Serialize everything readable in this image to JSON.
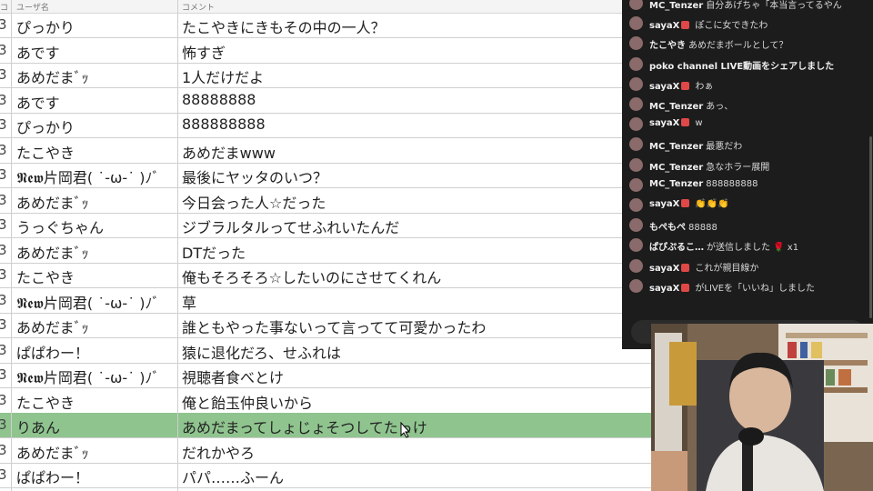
{
  "table": {
    "headers": [
      "コ",
      "ユーザ名",
      "コメント"
    ],
    "rows": [
      {
        "num": "3",
        "user": "ぴっかり",
        "comment": "たこやきにきもその中の一人？"
      },
      {
        "num": "3",
        "user": "あです",
        "comment": "怖すぎ"
      },
      {
        "num": "3",
        "user": "あめだまﾞｯ",
        "comment": "1人だけだよ"
      },
      {
        "num": "3",
        "user": "あです",
        "comment": "88888888"
      },
      {
        "num": "3",
        "user": "ぴっかり",
        "comment": "888888888"
      },
      {
        "num": "3",
        "user": "たこやき",
        "comment": "あめだまwww"
      },
      {
        "num": "3",
        "user": "𝕹𝖊𝖜片岡君( ˙-ω-˙ )ﾉﾞ",
        "comment": "最後にヤッタのいつ？"
      },
      {
        "num": "3",
        "user": "あめだまﾞｯ",
        "comment": "今日会った人☆だった"
      },
      {
        "num": "3",
        "user": "うっぐちゃん",
        "comment": "ジブラルタルってせふれいたんだ"
      },
      {
        "num": "3",
        "user": "あめだまﾞｯ",
        "comment": "DTだった"
      },
      {
        "num": "3",
        "user": "たこやき",
        "comment": "俺もそろそろ☆したいのにさせてくれん"
      },
      {
        "num": "3",
        "user": "𝕹𝖊𝖜片岡君( ˙-ω-˙ )ﾉﾞ",
        "comment": "草"
      },
      {
        "num": "3",
        "user": "あめだまﾞｯ",
        "comment": "誰ともやった事ないって言ってて可愛かったわ"
      },
      {
        "num": "3",
        "user": "ぱぱわー！",
        "comment": "猿に退化だろ、せふれは"
      },
      {
        "num": "3",
        "user": "𝕹𝖊𝖜片岡君( ˙-ω-˙ )ﾉﾞ",
        "comment": "視聴者食べとけ"
      },
      {
        "num": "3",
        "user": "たこやき",
        "comment": "俺と飴玉仲良いから"
      },
      {
        "num": "3",
        "user": "りあん",
        "comment": "あめだまってしょじょそつしてたっけ",
        "selected": true
      },
      {
        "num": "3",
        "user": "あめだまﾞｯ",
        "comment": "だれかやろ"
      },
      {
        "num": "3",
        "user": "ぱぱわー！",
        "comment": "パパ……ふーん"
      }
    ]
  },
  "chat": {
    "messages": [
      {
        "user": "MC_Tenzer",
        "badge": false,
        "text": "自分あげちゃ「本当言ってるやん"
      },
      {
        "user": "sayaX",
        "badge": true,
        "text": "ぽこに女できたわ"
      },
      {
        "user": "たこやき",
        "badge": false,
        "text": "あめだまボールとして？"
      },
      {
        "user": "poko channel LIVE動画をシェアしました",
        "badge": false,
        "text": ""
      },
      {
        "user": "sayaX",
        "badge": true,
        "text": "わぁ"
      },
      {
        "user": "MC_Tenzer",
        "badge": false,
        "text": "あっ、"
      },
      {
        "user": "sayaX",
        "badge": true,
        "text": "w"
      },
      {
        "user": "MC_Tenzer",
        "badge": false,
        "text": "最悪だわ"
      },
      {
        "user": "MC_Tenzer",
        "badge": false,
        "text": "急なホラー展開"
      },
      {
        "user": "MC_Tenzer",
        "badge": false,
        "text": "888888888"
      },
      {
        "user": "sayaX",
        "badge": true,
        "text": "👏👏👏"
      },
      {
        "user": "もぺもぺ",
        "badge": false,
        "text": "88888"
      },
      {
        "user": "ぱぴぷるこ…",
        "badge": false,
        "text": "が送信しました 🌹 x1"
      },
      {
        "user": "sayaX",
        "badge": true,
        "text": "これが親目線か"
      },
      {
        "user": "sayaX",
        "badge": true,
        "text": "がLIVEを「いいね」しました"
      }
    ]
  },
  "colors": {
    "selected_row": "#8fc48f",
    "chat_bg": "#1c1c1c",
    "badge": "#e04848"
  }
}
